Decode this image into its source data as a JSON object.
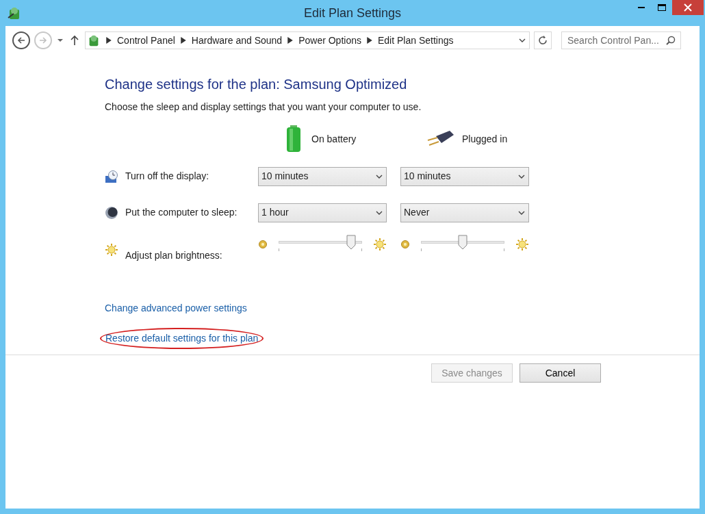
{
  "window": {
    "title": "Edit Plan Settings"
  },
  "breadcrumb": [
    "Control Panel",
    "Hardware and Sound",
    "Power Options",
    "Edit Plan Settings"
  ],
  "search": {
    "placeholder": "Search Control Pan..."
  },
  "heading": "Change settings for the plan: Samsung Optimized",
  "description": "Choose the sleep and display settings that you want your computer to use.",
  "columns": [
    {
      "kind": "battery",
      "label": "On battery"
    },
    {
      "kind": "plug",
      "label": "Plugged in"
    }
  ],
  "settings": [
    {
      "kind": "display",
      "label": "Turn off the display:",
      "values": [
        "10 minutes",
        "10 minutes"
      ]
    },
    {
      "kind": "sleep",
      "label": "Put the computer to sleep:",
      "values": [
        "1 hour",
        "Never"
      ]
    },
    {
      "kind": "brightness",
      "label": "Adjust plan brightness:",
      "sliders": [
        {
          "level": 0.87
        },
        {
          "level": 0.5
        }
      ]
    }
  ],
  "links": [
    {
      "label": "Change advanced power settings",
      "highlighted": false
    },
    {
      "label": "Restore default settings for this plan",
      "highlighted": true
    }
  ],
  "buttons": [
    {
      "label": "Save changes",
      "disabled": true
    },
    {
      "label": "Cancel",
      "disabled": false
    }
  ]
}
